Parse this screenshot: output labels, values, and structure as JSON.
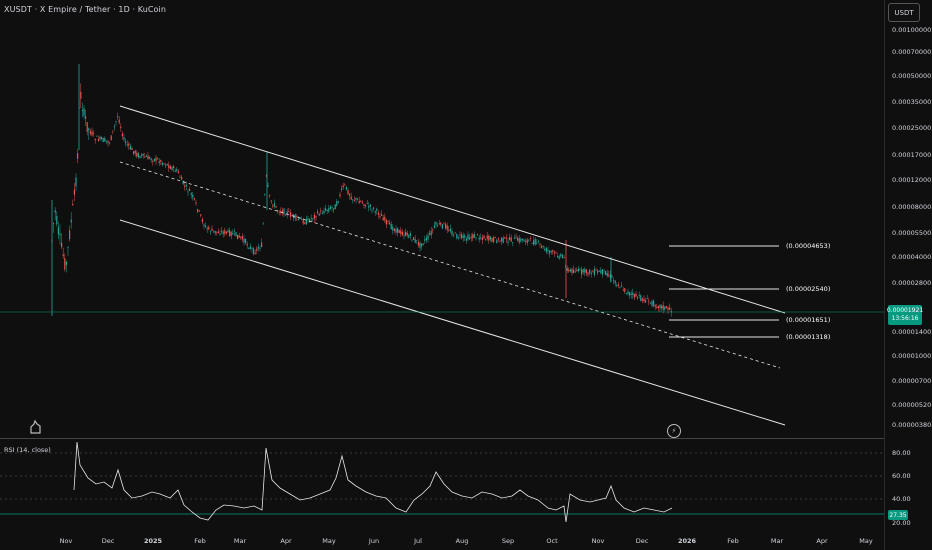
{
  "header": {
    "symbol_title": "XUSDT · X Empire / Tether · 1D · KuCoin",
    "currency_button": "USDT"
  },
  "price_axis": {
    "ticks": [
      "0.00100000",
      "0.00070000",
      "0.00050000",
      "0.00035000",
      "0.00025000",
      "0.00017000",
      "0.00012000",
      "0.00008000",
      "0.00005500",
      "0.00004000",
      "0.00002800",
      "0.00001400",
      "0.00001000",
      "0.00000700",
      "0.00000520",
      "0.00000380"
    ]
  },
  "current_price": {
    "value": "0.00001921",
    "countdown": "13:56:16"
  },
  "levels": [
    {
      "label": "(0.00004653)"
    },
    {
      "label": "(0.00002540)"
    },
    {
      "label": "(0.00001651)"
    },
    {
      "label": "(0.00001318)"
    }
  ],
  "rsi": {
    "title": "RSI (14, close)",
    "ticks": [
      "80.00",
      "60.00",
      "40.00",
      "20.00"
    ],
    "current_value": "27.35"
  },
  "time_axis": {
    "labels": [
      "Nov",
      "Dec",
      "2025",
      "Feb",
      "Mar",
      "Apr",
      "May",
      "Jun",
      "Jul",
      "Aug",
      "Sep",
      "Oct",
      "Nov",
      "Dec",
      "2026",
      "Feb",
      "Mar",
      "Apr",
      "May"
    ]
  },
  "colors": {
    "up": "#26a69a",
    "down": "#ef5350",
    "accent": "#089981",
    "channel": "#e6e6e6"
  },
  "icons": {
    "logo": "tradingview-logo-icon",
    "replay": "lightning-icon"
  }
}
